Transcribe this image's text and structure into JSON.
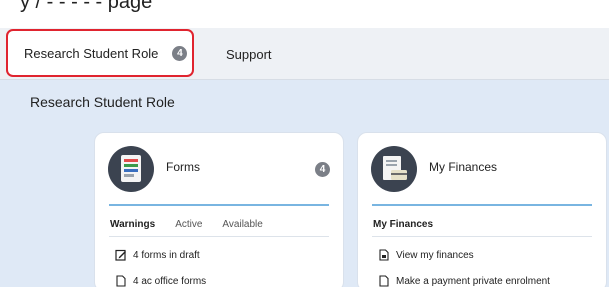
{
  "header": {
    "top_text": "y / ‑ ‑ ‑ ‑ ‑ page"
  },
  "tabs": [
    {
      "label": "Research Student Role",
      "count": "4"
    },
    {
      "label": "Support"
    }
  ],
  "section": {
    "title": "Research Student Role"
  },
  "forms_card": {
    "title": "Forms",
    "count": "4",
    "subtabs": [
      "Warnings",
      "Active",
      "Available"
    ],
    "items": [
      "4 forms in draft",
      "4 ac office forms"
    ]
  },
  "finances_card": {
    "title": "My Finances",
    "heading": "My Finances",
    "items": [
      "View my finances",
      "Make a payment private enrolment"
    ]
  },
  "colors": {
    "highlight": "#e0242f",
    "accent_line": "#79b5e1",
    "page_bg": "#dfe9f6"
  }
}
